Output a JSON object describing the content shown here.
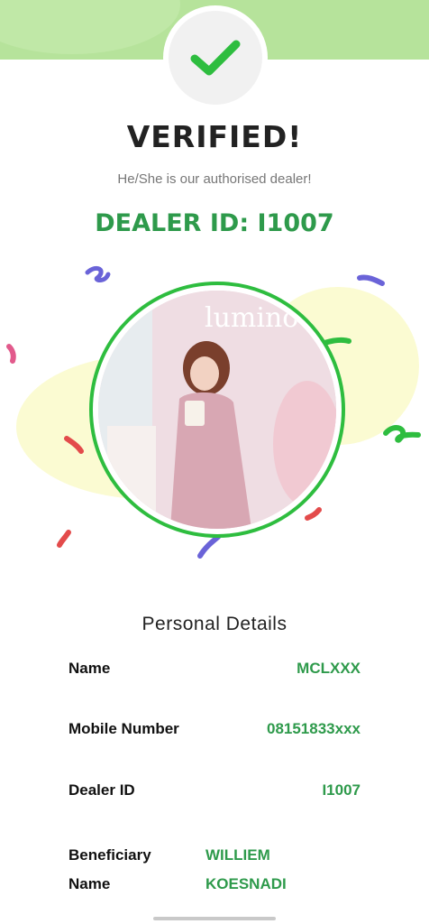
{
  "header": {
    "title": "VERIFIED!",
    "subtitle": "He/She is our authorised dealer!",
    "dealer_id": "DEALER ID: I1007",
    "check_icon": "check-icon",
    "accent_color": "#2e9a4b"
  },
  "photo": {
    "text": "lumino bea",
    "icon": "dealer-photo"
  },
  "details": {
    "title": "Personal Details",
    "rows": [
      {
        "label": "Name",
        "value": "MCLXXX"
      },
      {
        "label": "Mobile Number",
        "value": "08151833xxx"
      },
      {
        "label": "Dealer ID",
        "value": "I1007"
      }
    ],
    "beneficiary": {
      "label_1": "Beneficiary",
      "label_2": "Name",
      "value_1": "WILLIEM",
      "value_2": "KOESNADI"
    }
  }
}
